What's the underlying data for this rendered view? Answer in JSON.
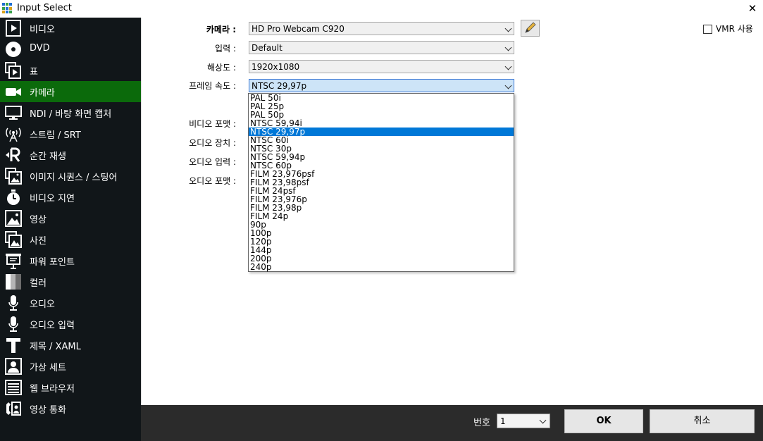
{
  "window": {
    "title": "Input Select",
    "close_glyph": "✕"
  },
  "sidebar": {
    "items": [
      {
        "label": "비디오",
        "icon": "video-file-icon",
        "active": false
      },
      {
        "label": "DVD",
        "icon": "disc-icon",
        "active": false
      },
      {
        "label": "표",
        "icon": "playlist-icon",
        "active": false
      },
      {
        "label": "카메라",
        "icon": "camera-icon",
        "active": true
      },
      {
        "label": "NDI / 바탕 화면 캡처",
        "icon": "monitor-icon",
        "active": false
      },
      {
        "label": "스트림 / SRT",
        "icon": "antenna-icon",
        "active": false
      },
      {
        "label": "순간 재생",
        "icon": "replay-icon",
        "active": false
      },
      {
        "label": "이미지 시퀀스 / 스팅어",
        "icon": "image-sequence-icon",
        "active": false
      },
      {
        "label": "비디오 지연",
        "icon": "timer-icon",
        "active": false
      },
      {
        "label": "영상",
        "icon": "picture-icon",
        "active": false
      },
      {
        "label": "사진",
        "icon": "photos-icon",
        "active": false
      },
      {
        "label": "파워 포인트",
        "icon": "presentation-icon",
        "active": false
      },
      {
        "label": "컬러",
        "icon": "color-icon",
        "active": false
      },
      {
        "label": "오디오",
        "icon": "microphone-icon",
        "active": false
      },
      {
        "label": "오디오 입력",
        "icon": "microphone-input-icon",
        "active": false
      },
      {
        "label": "제목 / XAML",
        "icon": "title-icon",
        "active": false
      },
      {
        "label": "가상 세트",
        "icon": "virtual-set-icon",
        "active": false
      },
      {
        "label": "웹 브라우저",
        "icon": "browser-icon",
        "active": false
      },
      {
        "label": "영상 통화",
        "icon": "video-call-icon",
        "active": false
      }
    ]
  },
  "form": {
    "camera": {
      "label": "카메라 :",
      "value": "HD Pro Webcam C920"
    },
    "input": {
      "label": "입력 :",
      "value": "Default"
    },
    "resolution": {
      "label": "해상도 :",
      "value": "1920x1080"
    },
    "frame_rate": {
      "label": "프레임 속도 :",
      "value": "NTSC 29,97p",
      "options": [
        "PAL 50i",
        "PAL 25p",
        "PAL 50p",
        "NTSC 59,94i",
        "NTSC 29,97p",
        "NTSC 60i",
        "NTSC 30p",
        "NTSC 59,94p",
        "NTSC 60p",
        "FILM 23,976psf",
        "FILM 23,98psf",
        "FILM 24psf",
        "FILM 23,976p",
        "FILM 23,98p",
        "FILM 24p",
        "90p",
        "100p",
        "120p",
        "144p",
        "200p",
        "240p"
      ],
      "selected_index": 4
    },
    "video_format": {
      "label": "비디오 포맷 :"
    },
    "audio_device": {
      "label": "오디오 장치 :"
    },
    "audio_input": {
      "label": "오디오 입력 :"
    },
    "audio_format": {
      "label": "오디오 포맷 :"
    },
    "vmr": {
      "label": "VMR 사용",
      "checked": false
    },
    "edit_icon": "pencil-icon"
  },
  "footer": {
    "number_label": "번호",
    "number_value": "1",
    "ok_label": "OK",
    "cancel_label": "취소"
  },
  "colors": {
    "sidebar_bg": "#111619",
    "active_item": "#0b6a0b",
    "footer_bg": "#2b2b2b",
    "dropdown_selected": "#0078d7"
  }
}
